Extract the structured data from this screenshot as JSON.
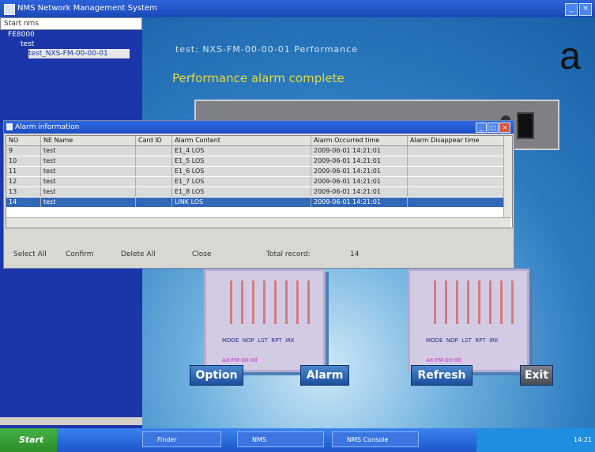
{
  "window": {
    "title": "NMS Network Management System"
  },
  "tree": {
    "header": "Start nms",
    "nodes": [
      "FE8000",
      "test",
      "test_NXS-FM-00-00-01"
    ]
  },
  "main": {
    "headline": "test: NXS-FM-00-00-01 Performance",
    "perf_title": "Performance alarm complete",
    "logo": "a"
  },
  "dialog": {
    "title": "Alarm information",
    "columns": [
      "NO",
      "NE Name",
      "Card ID",
      "Alarm Content",
      "Alarm Occurred time",
      "Alarm Disappear time"
    ],
    "rows": [
      [
        "9",
        "test",
        "",
        "E1_4 LOS",
        "2009-06-01 14:21:01",
        ""
      ],
      [
        "10",
        "test",
        "",
        "E1_5 LOS",
        "2009-06-01 14:21:01",
        ""
      ],
      [
        "11",
        "test",
        "",
        "E1_6 LOS",
        "2009-06-01 14:21:01",
        ""
      ],
      [
        "12",
        "test",
        "",
        "E1_7 LOS",
        "2009-06-01 14:21:01",
        ""
      ],
      [
        "13",
        "test",
        "",
        "E1_8 LOS",
        "2009-06-01 14:21:01",
        ""
      ],
      [
        "14",
        "test",
        "",
        "LINK LOS",
        "2009-06-01 14:21:01",
        ""
      ]
    ],
    "selected_row": 5,
    "footer": {
      "select_all": "Select All",
      "confirm": "Confirm",
      "delete_all": "Delete All",
      "close": "Close",
      "total_label": "Total record:",
      "total_value": "14"
    }
  },
  "panels": [
    {
      "labels": "MODE  NOP  LST  RPT  IRK",
      "code": "AX-FM-00-00"
    },
    {
      "labels": "MODE  NOP  LST  RPT  IRK",
      "code": "AX-FM-00-00"
    }
  ],
  "buttons": {
    "option": "Option",
    "alarm": "Alarm",
    "refresh": "Refresh",
    "exit": "Exit"
  },
  "taskbar": {
    "start": "Start",
    "tasks": [
      "Finder",
      "NMS",
      "NMS Console"
    ],
    "clock": "14:21"
  },
  "colors": {
    "accent": "#1b36a9",
    "selected_row": "#3268b8",
    "perf_text": "#e3d93a"
  }
}
